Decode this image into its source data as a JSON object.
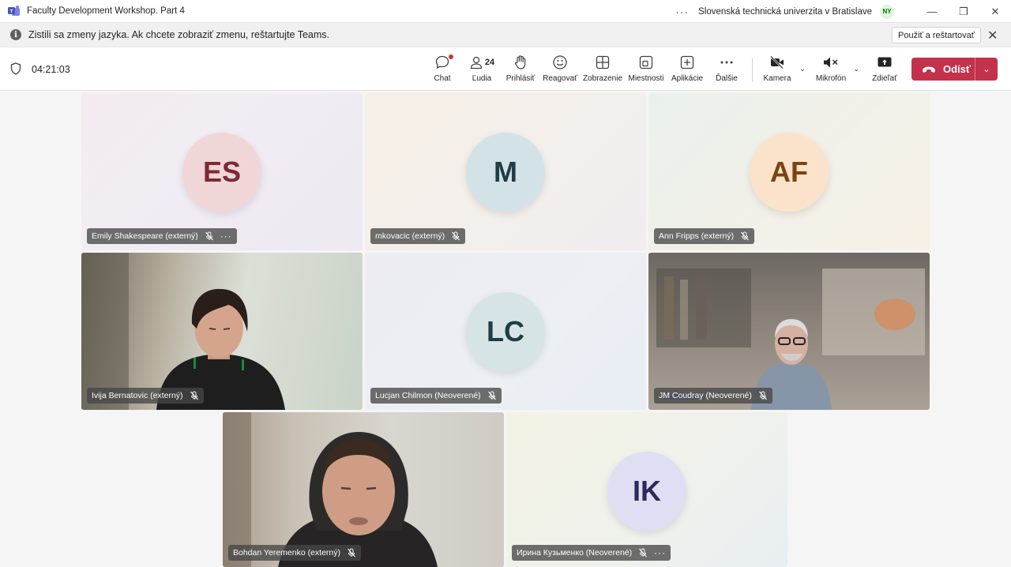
{
  "window": {
    "title": "Faculty Development Workshop. Part 4",
    "more": "···",
    "org_name": "Slovenská technická univerzita v Bratislave",
    "org_initials": "NY",
    "minimize": "—",
    "restore": "❐",
    "close": "✕"
  },
  "notification": {
    "icon": "i",
    "text": "Zistili sa zmeny jazyka. Ak chcete zobraziť zmenu, reštartujte Teams.",
    "action_label": "Použiť a reštartovať",
    "close": "✕"
  },
  "toolbar": {
    "timer": "04:21:03",
    "buttons": {
      "chat": "Chat",
      "people": "Ľudia",
      "people_count": "24",
      "raise": "Prihlásiť",
      "react": "Reagovať",
      "view": "Zobrazenie",
      "rooms": "Miestnosti",
      "apps": "Aplikácie",
      "more": "Ďalšie",
      "camera": "Kamera",
      "mic": "Mikrofón",
      "share": "Zdieľať",
      "leave": "Odísť"
    },
    "chevron": "⌄",
    "colors": {
      "leave": "#c4314b",
      "notification_dot": "#d13438"
    }
  },
  "participants": [
    {
      "name": "Emily Shakespeare (externý)",
      "initials": "ES",
      "avatar_bg": "#f1d6d8",
      "avatar_fg": "#7a2b35",
      "muted": true,
      "has_more": true,
      "video": false
    },
    {
      "name": "mkovacic (externý)",
      "initials": "M",
      "avatar_bg": "#d3e2e6",
      "avatar_fg": "#1f3d45",
      "muted": true,
      "has_more": false,
      "video": false
    },
    {
      "name": "Ann Fripps (externý)",
      "initials": "AF",
      "avatar_bg": "#fbe3cb",
      "avatar_fg": "#7a4410",
      "muted": true,
      "has_more": false,
      "video": false
    },
    {
      "name": "Ivija Bernatovic (externý)",
      "initials": "",
      "muted": true,
      "has_more": false,
      "video": true
    },
    {
      "name": "Lucjan Chilmon (Neoverené)",
      "initials": "LC",
      "avatar_bg": "#d6e4e6",
      "avatar_fg": "#1f3d45",
      "muted": true,
      "has_more": false,
      "video": false
    },
    {
      "name": "JM Coudray (Neoverené)",
      "initials": "",
      "muted": true,
      "has_more": false,
      "video": true
    },
    {
      "name": "Bohdan Yeremenko (externý)",
      "initials": "",
      "muted": true,
      "has_more": false,
      "video": true
    },
    {
      "name": "Ирина Кузьменко (Neoverené)",
      "initials": "IK",
      "avatar_bg": "#e0def2",
      "avatar_fg": "#2b2a5c",
      "muted": true,
      "has_more": true,
      "video": false
    }
  ],
  "tag_more": "···"
}
